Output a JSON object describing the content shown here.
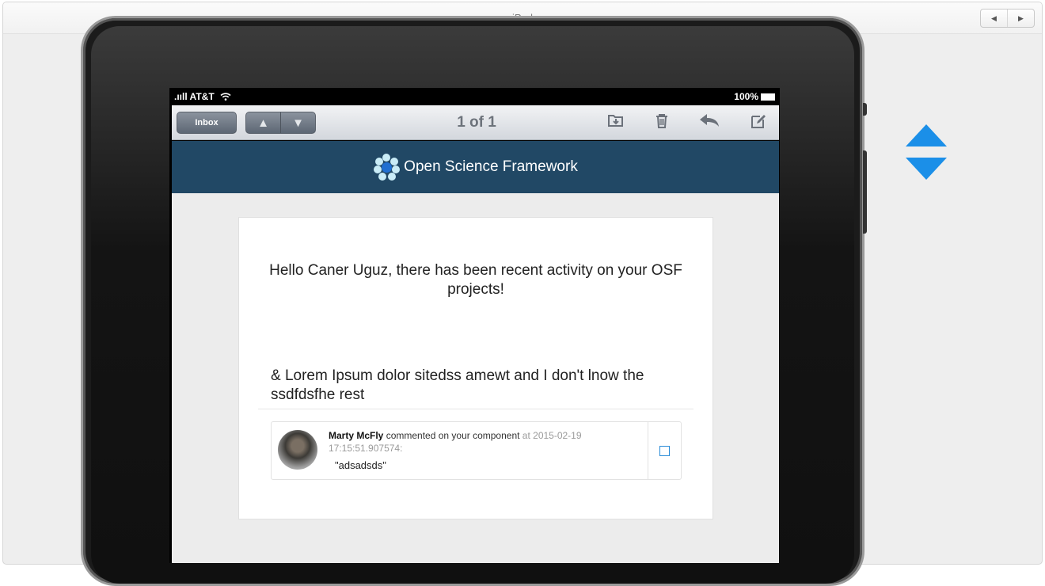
{
  "window": {
    "title": "iPad"
  },
  "nav": {
    "prev_icon": "◀",
    "next_icon": "▶"
  },
  "status_bar": {
    "carrier": ".ııll AT&T",
    "battery": "100%"
  },
  "mail_toolbar": {
    "inbox_label": "Inbox",
    "message_counter": "1 of 1",
    "up_icon": "▲",
    "down_icon": "▼",
    "tools": [
      "move-folder-icon",
      "trash-icon",
      "reply-icon",
      "compose-icon"
    ]
  },
  "email": {
    "brand": "Open Science Framework",
    "greeting": "Hello Caner Uguz, there has been recent activity on your OSF projects!",
    "project_title": "& Lorem Ipsum dolor sitedss amewt and I don't lnow the ssdfdsfhe rest",
    "comment": {
      "author": "Marty McFly",
      "action": " commented on your component",
      "meta": " at 2015-02-19 17:15:51.907574:",
      "text": "\"adsadsds\""
    }
  },
  "colors": {
    "brand_bar": "#214865",
    "accent": "#2a8cd8",
    "rotate_arrow": "#1b8fe8"
  }
}
